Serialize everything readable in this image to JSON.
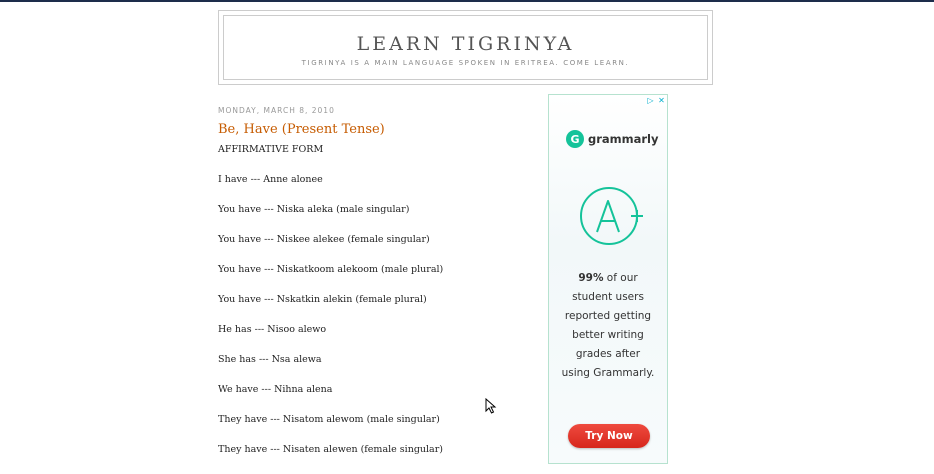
{
  "header": {
    "title": "LEARN TIGRINYA",
    "description": "TIGRINYA IS A MAIN LANGUAGE SPOKEN IN ERITREA. COME LEARN."
  },
  "post": {
    "date": "MONDAY, MARCH 8, 2010",
    "title": "Be, Have (Present Tense)",
    "lines": [
      "AFFIRMATIVE FORM",
      "I have --- Anne alonee",
      "You have --- Niska aleka (male singular)",
      "You have --- Niskee alekee (female singular)",
      "You have --- Niskatkoom alekoom (male plural)",
      "You have --- Nskatkin alekin (female plural)",
      "He has --- Nisoo alewo",
      "She has --- Nsa alewa",
      "We have --- Nihna alena",
      "They have --- Nisatom alewom (male singular)",
      "They have --- Nisaten alewen (female singular)"
    ]
  },
  "ad": {
    "brand": "grammarly",
    "logo_letter": "G",
    "grade": "A+",
    "stat": "99%",
    "text_line1_rest": " of our",
    "text_lines": [
      "student users",
      "reported getting",
      "better writing",
      "grades after",
      "using Grammarly."
    ],
    "button": "Try Now",
    "choices_icon": "adchoices-icon",
    "close_icon": "close-icon",
    "accent_color": "#15c39a",
    "button_color": "#e0342a"
  }
}
